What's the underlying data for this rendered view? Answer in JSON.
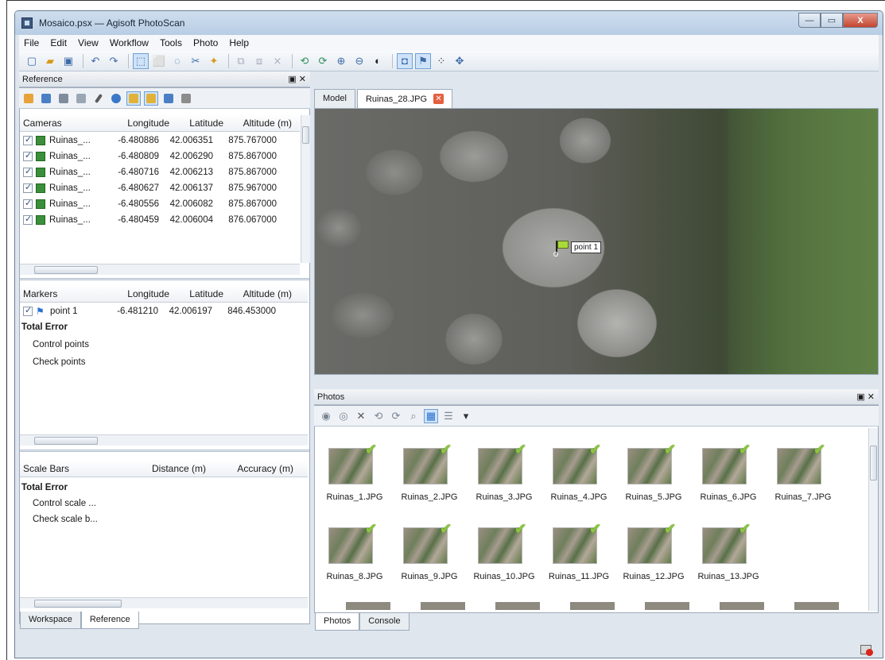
{
  "window": {
    "title": "Mosaico.psx — Agisoft PhotoScan",
    "controls": {
      "minimize": "—",
      "maximize": "▭",
      "close": "X"
    }
  },
  "menu": [
    {
      "label": "File"
    },
    {
      "label": "Edit"
    },
    {
      "label": "View"
    },
    {
      "label": "Workflow"
    },
    {
      "label": "Tools"
    },
    {
      "label": "Photo"
    },
    {
      "label": "Help"
    }
  ],
  "reference_panel": {
    "title": "Reference",
    "cameras": {
      "headers": [
        "Cameras",
        "Longitude",
        "Latitude",
        "Altitude (m)"
      ],
      "rows": [
        {
          "name": "Ruinas_...",
          "longitude": "-6.480886",
          "latitude": "42.006351",
          "altitude": "875.767000"
        },
        {
          "name": "Ruinas_...",
          "longitude": "-6.480809",
          "latitude": "42.006290",
          "altitude": "875.867000"
        },
        {
          "name": "Ruinas_...",
          "longitude": "-6.480716",
          "latitude": "42.006213",
          "altitude": "875.867000"
        },
        {
          "name": "Ruinas_...",
          "longitude": "-6.480627",
          "latitude": "42.006137",
          "altitude": "875.967000"
        },
        {
          "name": "Ruinas_...",
          "longitude": "-6.480556",
          "latitude": "42.006082",
          "altitude": "875.867000"
        },
        {
          "name": "Ruinas_...",
          "longitude": "-6.480459",
          "latitude": "42.006004",
          "altitude": "876.067000"
        }
      ]
    },
    "markers": {
      "headers": [
        "Markers",
        "Longitude",
        "Latitude",
        "Altitude (m)"
      ],
      "rows": [
        {
          "name": "point 1",
          "longitude": "-6.481210",
          "latitude": "42.006197",
          "altitude": "846.453000"
        }
      ],
      "total_error": "Total Error",
      "control_points": "Control points",
      "check_points": "Check points"
    },
    "scale_bars": {
      "headers": [
        "Scale Bars",
        "Distance (m)",
        "Accuracy (m)"
      ],
      "total_error": "Total Error",
      "control": "Control scale ...",
      "check": "Check scale b..."
    },
    "bottom_tabs": [
      "Workspace",
      "Reference"
    ]
  },
  "view_tabs": [
    "Model",
    "Ruinas_28.JPG"
  ],
  "photo_view": {
    "marker_label": "point 1"
  },
  "photos_panel": {
    "title": "Photos",
    "thumbnails": [
      "Ruinas_1.JPG",
      "Ruinas_2.JPG",
      "Ruinas_3.JPG",
      "Ruinas_4.JPG",
      "Ruinas_5.JPG",
      "Ruinas_6.JPG",
      "Ruinas_7.JPG",
      "Ruinas_8.JPG",
      "Ruinas_9.JPG",
      "Ruinas_10.JPG",
      "Ruinas_11.JPG",
      "Ruinas_12.JPG",
      "Ruinas_13.JPG"
    ],
    "bottom_tabs": [
      "Photos",
      "Console"
    ]
  },
  "colors": {
    "accent": "#2a6fd1",
    "check": "#8bc53f",
    "close_tab": "#e4603e"
  }
}
